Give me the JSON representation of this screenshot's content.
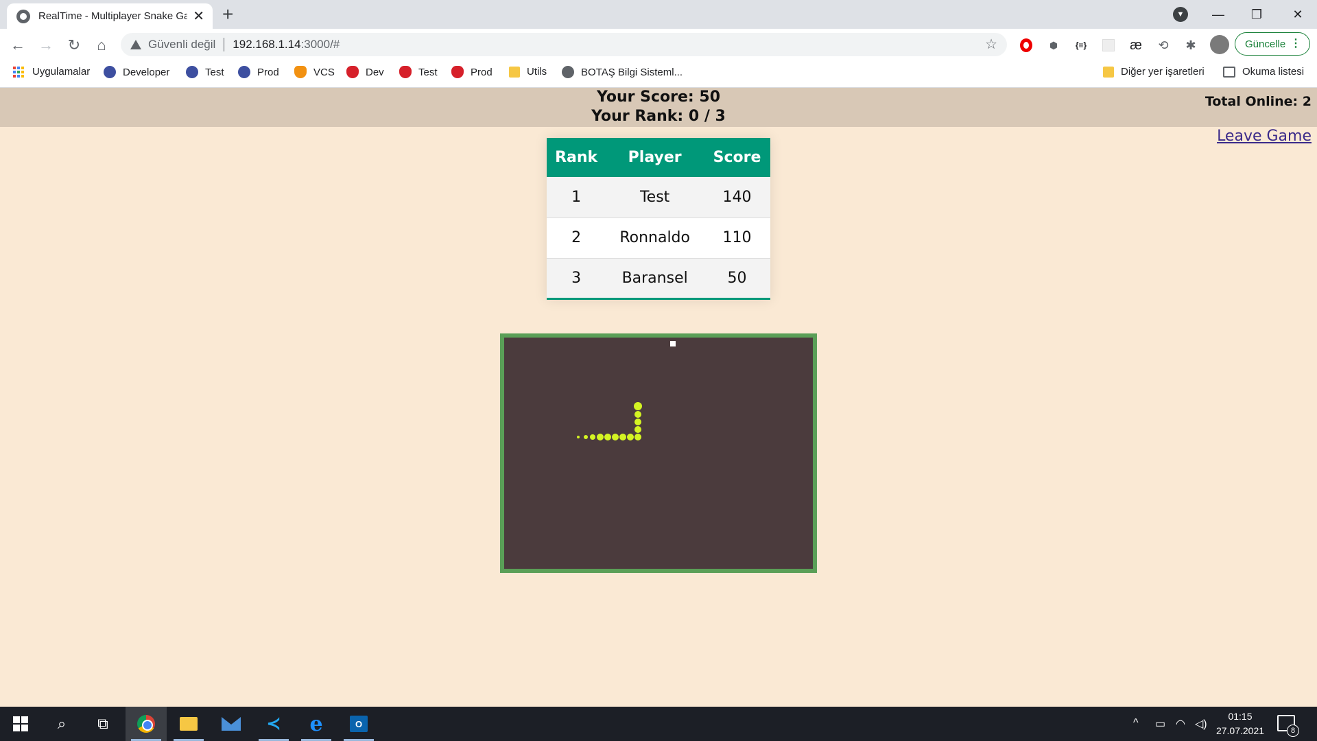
{
  "browser": {
    "tab_title": "RealTime - Multiplayer Snake Ga",
    "security_label": "Güvenli değil",
    "url_host": "192.168.1.14",
    "url_rest": ":3000/#",
    "update_label": "Güncelle",
    "bookmarks": [
      {
        "label": "Uygulamalar",
        "icon": "apps-icon"
      },
      {
        "label": "Developer",
        "icon": "dev-icon"
      },
      {
        "label": "Test",
        "icon": "dev-icon"
      },
      {
        "label": "Prod",
        "icon": "dev-icon"
      },
      {
        "label": "VCS",
        "icon": "vcs-icon"
      },
      {
        "label": "Dev",
        "icon": "botas-icon"
      },
      {
        "label": "Test",
        "icon": "botas-icon"
      },
      {
        "label": "Prod",
        "icon": "botas-icon"
      },
      {
        "label": "Utils",
        "icon": "folder-icon"
      },
      {
        "label": "BOTAŞ Bilgi Sisteml...",
        "icon": "globe-icon"
      }
    ],
    "other_bookmarks": "Diğer yer işaretleri",
    "reading_list": "Okuma listesi"
  },
  "game": {
    "score_label": "Your Score: 50",
    "rank_label": "Your Rank: 0 / 3",
    "total_online": "Total Online: 2",
    "leave_game": "Leave Game",
    "leaderboard": {
      "headers": [
        "Rank",
        "Player",
        "Score"
      ],
      "rows": [
        [
          "1",
          "Test",
          "140"
        ],
        [
          "2",
          "Ronnaldo",
          "110"
        ],
        [
          "3",
          "Baransel",
          "50"
        ]
      ]
    },
    "board": {
      "border_color": "#5a9f57",
      "background_color": "#4b3b3d",
      "snake_color": "#d4f423",
      "food_color": "#ffffff"
    }
  },
  "taskbar": {
    "time": "01:15",
    "date": "27.07.2021",
    "notification_count": "8"
  }
}
